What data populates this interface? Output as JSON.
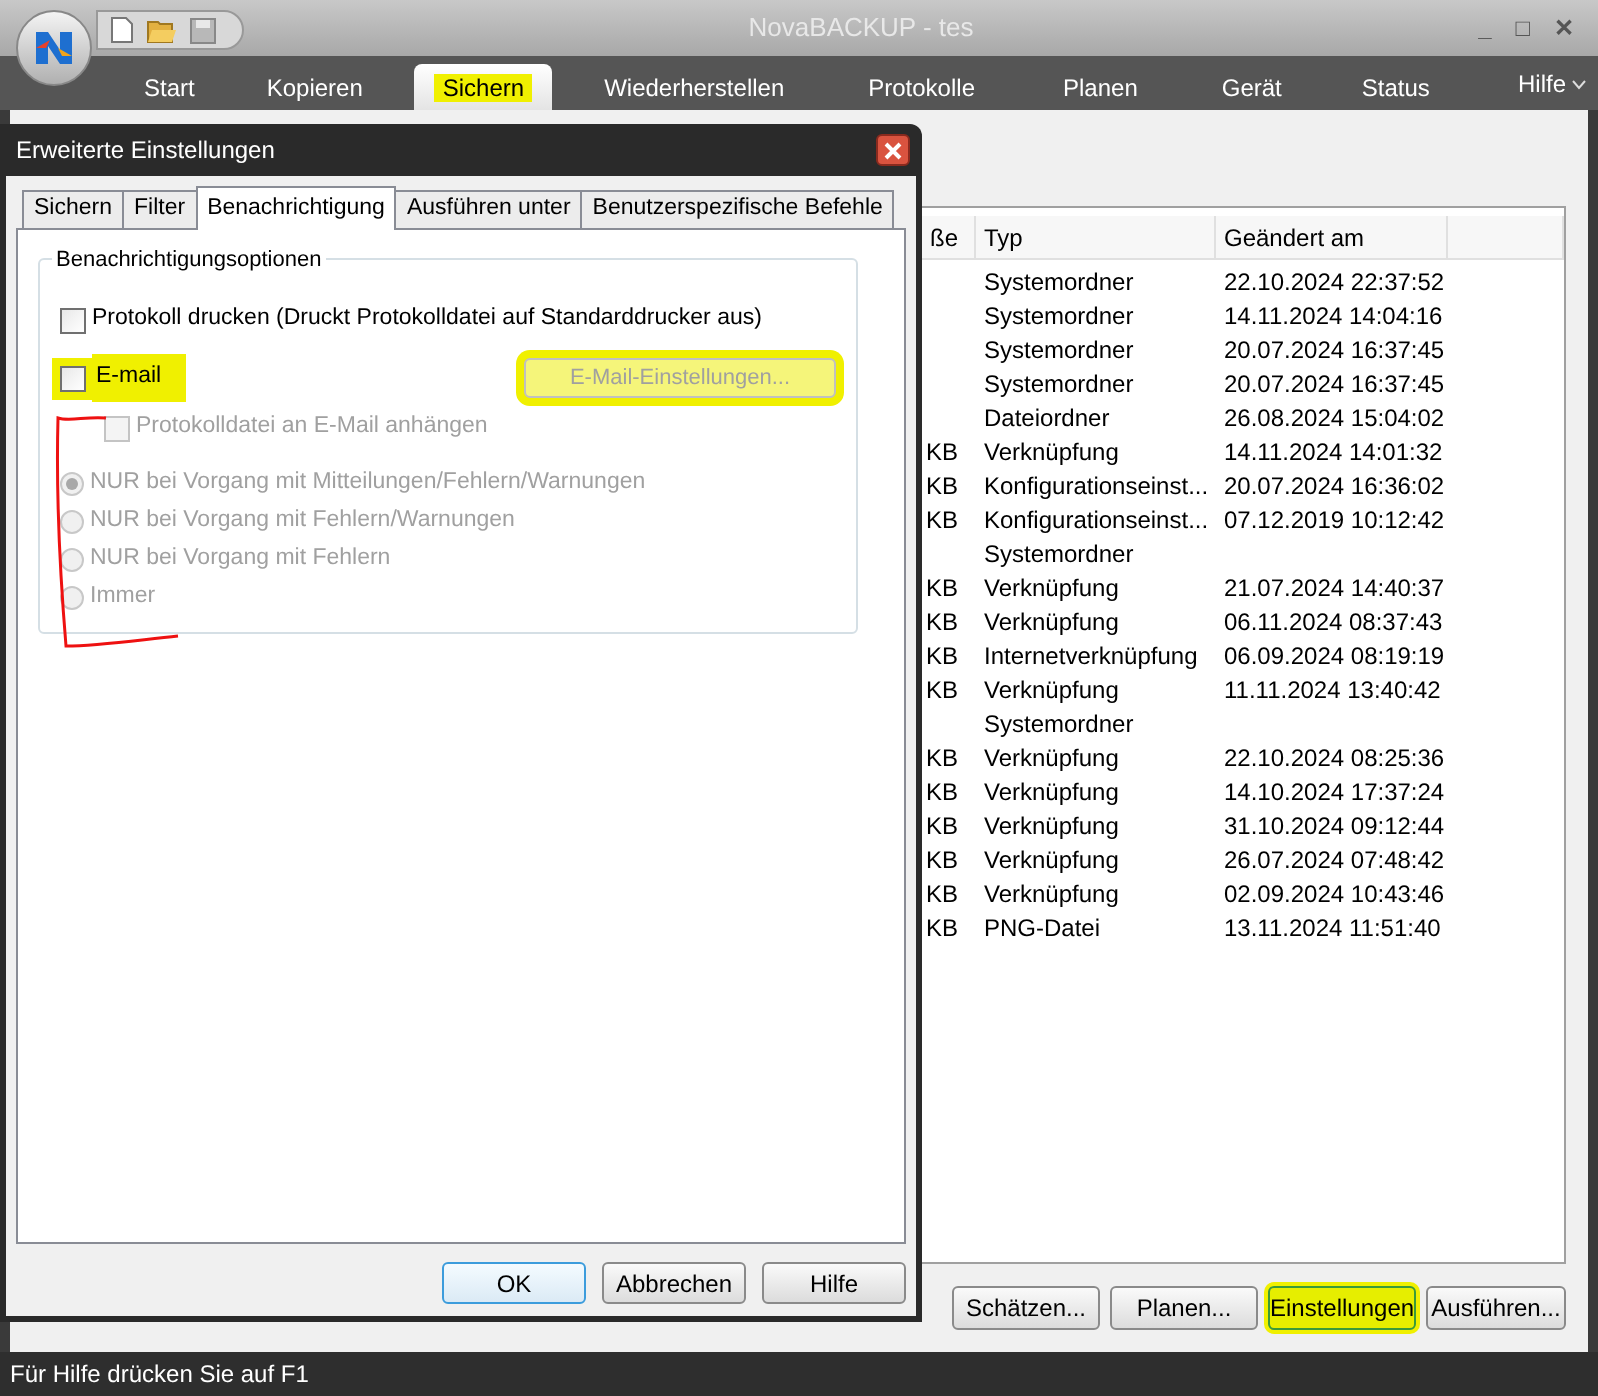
{
  "window": {
    "title": "NovaBACKUP - tes",
    "controls": [
      "_",
      "□",
      "✕"
    ]
  },
  "ribbon": {
    "tabs": [
      {
        "label": "Start",
        "selected": false,
        "highlighted": false
      },
      {
        "label": "Kopieren",
        "selected": false,
        "highlighted": false
      },
      {
        "label": "Sichern",
        "selected": true,
        "highlighted": true
      },
      {
        "label": "Wiederherstellen",
        "selected": false,
        "highlighted": false
      },
      {
        "label": "Protokolle",
        "selected": false,
        "highlighted": false
      },
      {
        "label": "Planen",
        "selected": false,
        "highlighted": false
      },
      {
        "label": "Gerät",
        "selected": false,
        "highlighted": false
      },
      {
        "label": "Status",
        "selected": false,
        "highlighted": false
      }
    ],
    "help": "Hilfe"
  },
  "file_list": {
    "columns": [
      "ße",
      "Typ",
      "Geändert am"
    ],
    "rows": [
      {
        "column_1": "",
        "type": "Systemordner",
        "modified": "22.10.2024 22:37:52"
      },
      {
        "column_1": "",
        "type": "Systemordner",
        "modified": "14.11.2024 14:04:16"
      },
      {
        "column_1": "",
        "type": "Systemordner",
        "modified": "20.07.2024 16:37:45"
      },
      {
        "column_1": "",
        "type": "Systemordner",
        "modified": "20.07.2024 16:37:45"
      },
      {
        "column_1": "",
        "type": "Dateiordner",
        "modified": "26.08.2024 15:04:02"
      },
      {
        "column_1": "KB",
        "type": "Verknüpfung",
        "modified": "14.11.2024 14:01:32"
      },
      {
        "column_1": "KB",
        "type": "Konfigurationseinst...",
        "modified": "20.07.2024 16:36:02"
      },
      {
        "column_1": "KB",
        "type": "Konfigurationseinst...",
        "modified": "07.12.2019 10:12:42"
      },
      {
        "column_1": "",
        "type": "Systemordner",
        "modified": ""
      },
      {
        "column_1": "KB",
        "type": "Verknüpfung",
        "modified": "21.07.2024 14:40:37"
      },
      {
        "column_1": "KB",
        "type": "Verknüpfung",
        "modified": "06.11.2024 08:37:43"
      },
      {
        "column_1": "KB",
        "type": "Internetverknüpfung",
        "modified": "06.09.2024 08:19:19"
      },
      {
        "column_1": "KB",
        "type": "Verknüpfung",
        "modified": "11.11.2024 13:40:42"
      },
      {
        "column_1": "",
        "type": "Systemordner",
        "modified": ""
      },
      {
        "column_1": "KB",
        "type": "Verknüpfung",
        "modified": "22.10.2024 08:25:36"
      },
      {
        "column_1": "KB",
        "type": "Verknüpfung",
        "modified": "14.10.2024 17:37:24"
      },
      {
        "column_1": "KB",
        "type": "Verknüpfung",
        "modified": "31.10.2024 09:12:44"
      },
      {
        "column_1": "KB",
        "type": "Verknüpfung",
        "modified": "26.07.2024 07:48:42"
      },
      {
        "column_1": "KB",
        "type": "Verknüpfung",
        "modified": "02.09.2024 10:43:46"
      },
      {
        "column_1": "KB",
        "type": "PNG-Datei",
        "modified": "13.11.2024 11:51:40"
      }
    ]
  },
  "action_buttons": [
    {
      "label": "Schätzen...",
      "highlighted": false
    },
    {
      "label": "Planen...",
      "highlighted": false
    },
    {
      "label": "Einstellungen",
      "highlighted": true
    },
    {
      "label": "Ausführen...",
      "highlighted": false
    }
  ],
  "status_bar": "Für Hilfe drücken Sie auf F1",
  "dialog": {
    "title": "Erweiterte Einstellungen",
    "tabs": [
      {
        "label": "Sichern",
        "selected": false
      },
      {
        "label": "Filter",
        "selected": false
      },
      {
        "label": "Benachrichtigung",
        "selected": true
      },
      {
        "label": "Ausführen unter",
        "selected": false
      },
      {
        "label": "Benutzerspezifische Befehle",
        "selected": false
      }
    ],
    "group": "Benachrichtigungsoptionen",
    "print_log": {
      "label": "Protokoll drucken (Druckt Protokolldatei auf Standarddrucker aus)",
      "checked": false,
      "disabled": false
    },
    "email": {
      "label": "E-mail",
      "checked": false,
      "highlighted": true
    },
    "email_settings": {
      "label": "E-Mail-Einstellungen...",
      "disabled": true,
      "highlighted": true
    },
    "attach_log": {
      "label": "Protokolldatei an E-Mail anhängen",
      "checked": false,
      "disabled": true
    },
    "radios": [
      {
        "label": "NUR bei Vorgang mit Mitteilungen/Fehlern/Warnungen",
        "selected": true,
        "disabled": true
      },
      {
        "label": "NUR bei Vorgang mit Fehlern/Warnungen",
        "selected": false,
        "disabled": true
      },
      {
        "label": "NUR bei Vorgang mit Fehlern",
        "selected": false,
        "disabled": true
      },
      {
        "label": "Immer",
        "selected": false,
        "disabled": true
      }
    ],
    "red_bracket": true,
    "buttons": [
      "OK",
      "Abbrechen",
      "Hilfe"
    ]
  }
}
